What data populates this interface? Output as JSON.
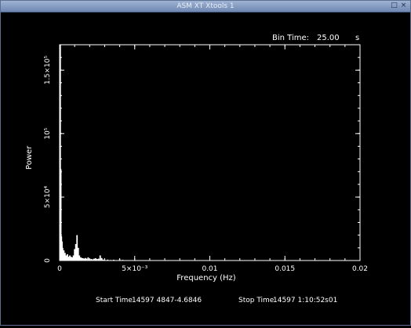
{
  "window": {
    "title": "ASM XT Xtools 1",
    "maximize_icon": "maximize-icon",
    "close_icon": "close-icon"
  },
  "header": {
    "bin_time_label": "Bin Time:",
    "bin_time_value": "25.00",
    "bin_time_unit": "s"
  },
  "footer": {
    "start_label": "Start Time",
    "start_value": "14597 4847-4.6846",
    "stop_label": "Stop Time",
    "stop_value": "14597 1:10:52s01"
  },
  "chart_data": {
    "type": "bar",
    "xlabel": "Frequency (Hz)",
    "ylabel": "Power",
    "xlim": [
      0,
      0.02
    ],
    "ylim": [
      0,
      170000
    ],
    "x_ticks": [
      {
        "value": 0,
        "label": "0"
      },
      {
        "value": 0.005,
        "label": "5×10⁻³"
      },
      {
        "value": 0.01,
        "label": "0.01"
      },
      {
        "value": 0.015,
        "label": "0.015"
      },
      {
        "value": 0.02,
        "label": "0.02"
      }
    ],
    "y_ticks": [
      {
        "value": 0,
        "label": "0"
      },
      {
        "value": 50000,
        "label": "5×10⁴"
      },
      {
        "value": 100000,
        "label": "10⁵"
      },
      {
        "value": 150000,
        "label": "1.5×10⁵"
      }
    ],
    "x": [
      4e-05,
      8e-05,
      0.00012,
      0.00016,
      0.0002,
      0.00028,
      0.00036,
      0.00044,
      0.00052,
      0.0006,
      0.00068,
      0.00076,
      0.00084,
      0.00092,
      0.001,
      0.00108,
      0.00116,
      0.00124,
      0.00132,
      0.0014,
      0.00148,
      0.00156,
      0.00164,
      0.00172,
      0.0018,
      0.0019,
      0.002,
      0.0021,
      0.0022,
      0.0023,
      0.0024,
      0.0025,
      0.0026,
      0.0027,
      0.0028,
      0.0029,
      0.003,
      0.0032,
      0.0034,
      0.0036,
      0.0038,
      0.004,
      0.0042,
      0.0044,
      0.0046,
      0.0048,
      0.005
    ],
    "values": [
      170000,
      72000,
      19000,
      15000,
      10000,
      8000,
      6000,
      4000,
      5000,
      3000,
      4000,
      3000,
      2500,
      4000,
      9000,
      13000,
      20000,
      10000,
      4000,
      2500,
      2000,
      1800,
      1500,
      2000,
      1500,
      2500,
      1500,
      1200,
      1000,
      1500,
      1800,
      1200,
      1500,
      4000,
      2000,
      800,
      500,
      700,
      400,
      600,
      300,
      900,
      500,
      300,
      200,
      300,
      200
    ]
  }
}
